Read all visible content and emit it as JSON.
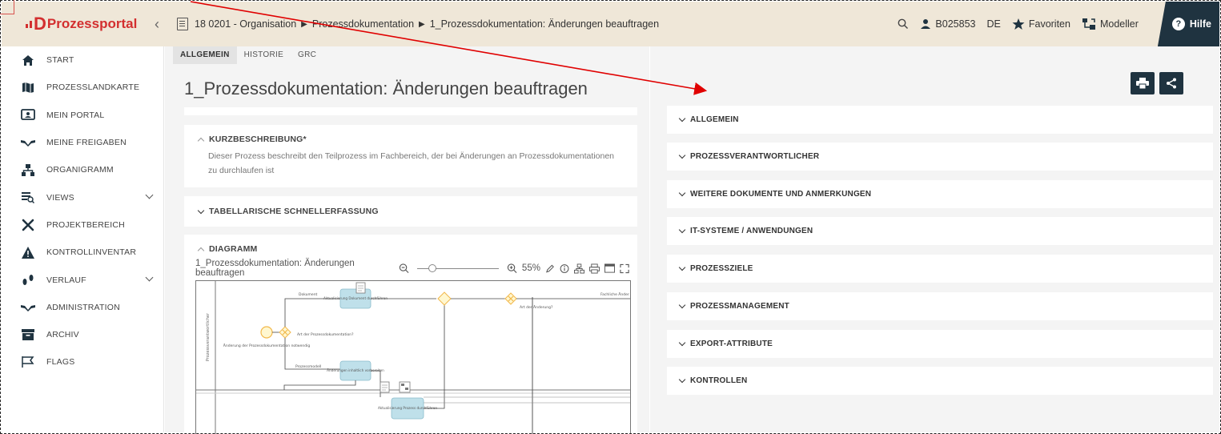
{
  "brand": {
    "name": "Prozessportal",
    "letter": "D"
  },
  "breadcrumb": {
    "items": [
      "18 0201 - Organisation",
      "Prozessdokumentation",
      "1_Prozessdokumentation: Änderungen beauftragen"
    ],
    "separator": "▶"
  },
  "topbar": {
    "user": "B025853",
    "language": "DE",
    "favorites_label": "Favoriten",
    "modeller_label": "Modeller",
    "help_label": "Hilfe"
  },
  "sidebar": {
    "items": [
      {
        "label": "START",
        "icon": "home-icon"
      },
      {
        "label": "PROZESSLANDKARTE",
        "icon": "map-icon"
      },
      {
        "label": "MEIN PORTAL",
        "icon": "portal-icon"
      },
      {
        "label": "MEINE FREIGABEN",
        "icon": "handshake-icon"
      },
      {
        "label": "ORGANIGRAMM",
        "icon": "org-chart-icon"
      },
      {
        "label": "VIEWS",
        "icon": "views-icon",
        "expandable": true
      },
      {
        "label": "PROJEKTBEREICH",
        "icon": "tools-icon"
      },
      {
        "label": "KONTROLLINVENTAR",
        "icon": "warning-icon"
      },
      {
        "label": "VERLAUF",
        "icon": "footsteps-icon",
        "expandable": true
      },
      {
        "label": "ADMINISTRATION",
        "icon": "handshake-icon"
      },
      {
        "label": "ARCHIV",
        "icon": "archive-icon"
      },
      {
        "label": "FLAGS",
        "icon": "flag-icon"
      }
    ]
  },
  "tabs": [
    {
      "label": "ALLGEMEIN",
      "active": true
    },
    {
      "label": "HISTORIE",
      "active": false
    },
    {
      "label": "GRC",
      "active": false
    }
  ],
  "page_title": "1_Prozessdokumentation: Änderungen beauftragen",
  "kurzbeschreibung": {
    "title": "KURZBESCHREIBUNG*",
    "text": "Dieser Prozess beschreibt den Teilprozess im Fachbereich, der bei Änderungen an Prozessdokumentationen zu durchlaufen ist"
  },
  "tabellarisch": {
    "title": "TABELLARISCHE SCHNELLERFASSUNG"
  },
  "diagramm": {
    "title": "DIAGRAMM",
    "name": "1_Prozessdokumentation: Änderungen beauftragen",
    "zoom": "55%",
    "lane_label": "Prozessverantwortlicher",
    "start_label": "Änderung der Prozessdokumentation notwendig",
    "gateway1_label": "Art der Prozessdokumentation?",
    "branch_top_label": "Dokument",
    "branch_bottom_label": "Prozessmodell",
    "task1": "Aktualisierung Dokument durchführen",
    "task2": "Änderungen inhaltlich vorbereiten",
    "task3": "Aktualisierung Prozess durchführen",
    "gateway3_label": "Art der Änderung?",
    "right_edge_label": "Fachliche Änder"
  },
  "right_sections": [
    "ALLGEMEIN",
    "PROZESSVERANTWORTLICHER",
    "WEITERE DOKUMENTE UND ANMERKUNGEN",
    "IT-SYSTEME / ANWENDUNGEN",
    "PROZESSZIELE",
    "PROZESSMANAGEMENT",
    "EXPORT-ATTRIBUTE",
    "KONTROLLEN"
  ],
  "colors": {
    "brand_red": "#d32f2f",
    "topbar_bg": "#efe7d8",
    "navy": "#1f3340",
    "task_fill": "#bfe0ea",
    "gateway_orange": "#f2b84b",
    "annotation_arrow": "#e00000"
  }
}
